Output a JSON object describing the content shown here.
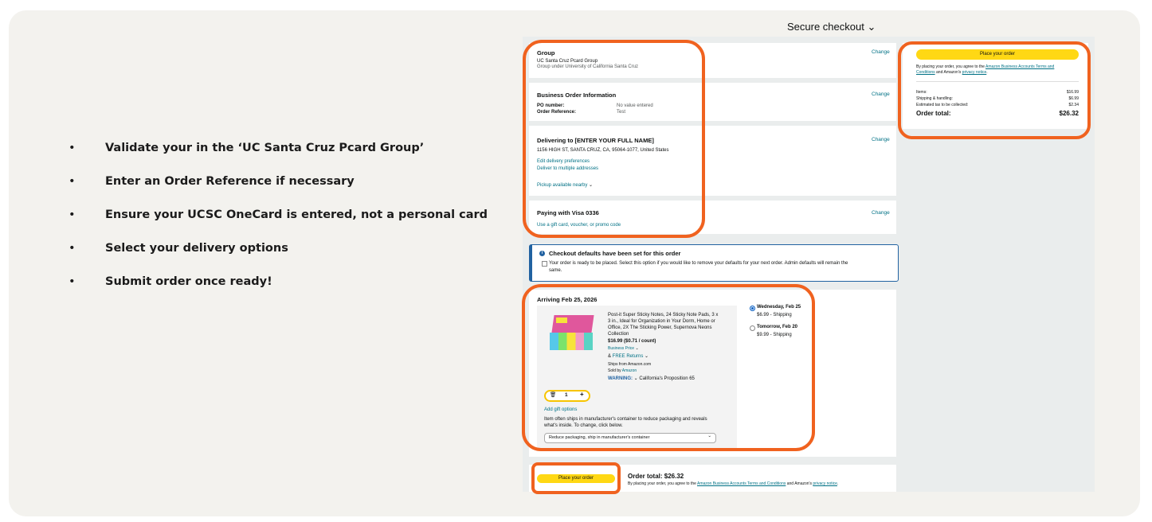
{
  "bullets": [
    "Validate your in the ‘UC Santa Cruz Pcard Group’",
    "Enter an Order Reference if necessary",
    "Ensure your UCSC OneCard is entered, not a personal card",
    "Select your delivery options",
    "Submit order once ready!"
  ],
  "bullet_char": "•",
  "header": "Secure checkout ⌄",
  "group": {
    "title": "Group",
    "name": "UC Santa Cruz Pcard Group",
    "sub": "Group under University of California Santa Cruz",
    "change": "Change"
  },
  "business": {
    "title": "Business Order Information",
    "po_label": "PO number:",
    "po_value": "No value entered",
    "ref_label": "Order Reference:",
    "ref_value": "Test",
    "change": "Change"
  },
  "delivery": {
    "title": "Delivering to [ENTER YOUR FULL NAME]",
    "address": "1156 HIGH ST, SANTA CRUZ, CA, 95064-1077, United States",
    "edit": "Edit delivery preferences",
    "multi": "Deliver to multiple addresses",
    "pickup": "Pickup available nearby",
    "change": "Change"
  },
  "payment": {
    "title": "Paying with Visa 0336",
    "gift": "Use a gift card, voucher, or promo code",
    "change": "Change"
  },
  "defaults": {
    "title": "Checkout defaults have been set for this order",
    "text1": "Your order is ready to be placed. Select this option if you would like to remove your defaults for your next order. Admin defaults will remain the",
    "text2": "same."
  },
  "arrival": {
    "title": "Arriving Feb 25, 2026",
    "product": [
      "Post-it Super Sticky Notes, 24 Sticky Note Pads, 3 x",
      "3 in., Ideal for Organization in Your Dorm, Home or",
      "Office, 2X The Sticking Power, Supernova Neons",
      "Collection"
    ],
    "price": "$16.99 ($0.71 / count)",
    "business_price": "Business Price",
    "free_returns_prefix": "& ",
    "free_returns": "FREE Returns",
    "ships_from": "Ships from Amazon.com",
    "sold_by_prefix": "Sold by ",
    "sold_by": "Amazon",
    "warning": "WARNING:",
    "warning_text": "California's Proposition 65",
    "qty": "1",
    "gift_options": "Add gift options",
    "packaging_note1": "Item often ships in manufacturer's container to reduce packaging and reveals",
    "packaging_note2": "what's inside. To change, click below.",
    "packaging_select": "Reduce packaging, ship in manufacturer's container",
    "option1_day": "Wednesday, Feb 25",
    "option1_price": "$6.99 - Shipping",
    "option2_day": "Tomorrow, Feb 20",
    "option2_price": "$9.99 - Shipping"
  },
  "summary": {
    "button": "Place your order",
    "agree_prefix": "By placing your order, you agree to the ",
    "terms": "Amazon Business Accounts Terms and",
    "terms2": "Conditions",
    "agree_mid": " and Amazon's ",
    "privacy": "privacy notice",
    "items_label": "Items:",
    "items_value": "$16.99",
    "shipping_label": "Shipping & handling:",
    "shipping_value": "$6.99",
    "tax_label": "Estimated tax to be collected:",
    "tax_value": "$2.34",
    "total_label": "Order total:",
    "total_value": "$26.32"
  },
  "bottom": {
    "button": "Place your order",
    "total": "Order total: $26.32",
    "agree_prefix": "By placing your order, you agree to the ",
    "terms": "Amazon Business Accounts Terms and Conditions",
    "agree_mid": " and Amazon's ",
    "privacy": "privacy notice",
    "end": "."
  },
  "colors": {
    "highlight": "#f0621f",
    "button": "#ffd814",
    "link": "#007185",
    "info": "#2162a1"
  }
}
